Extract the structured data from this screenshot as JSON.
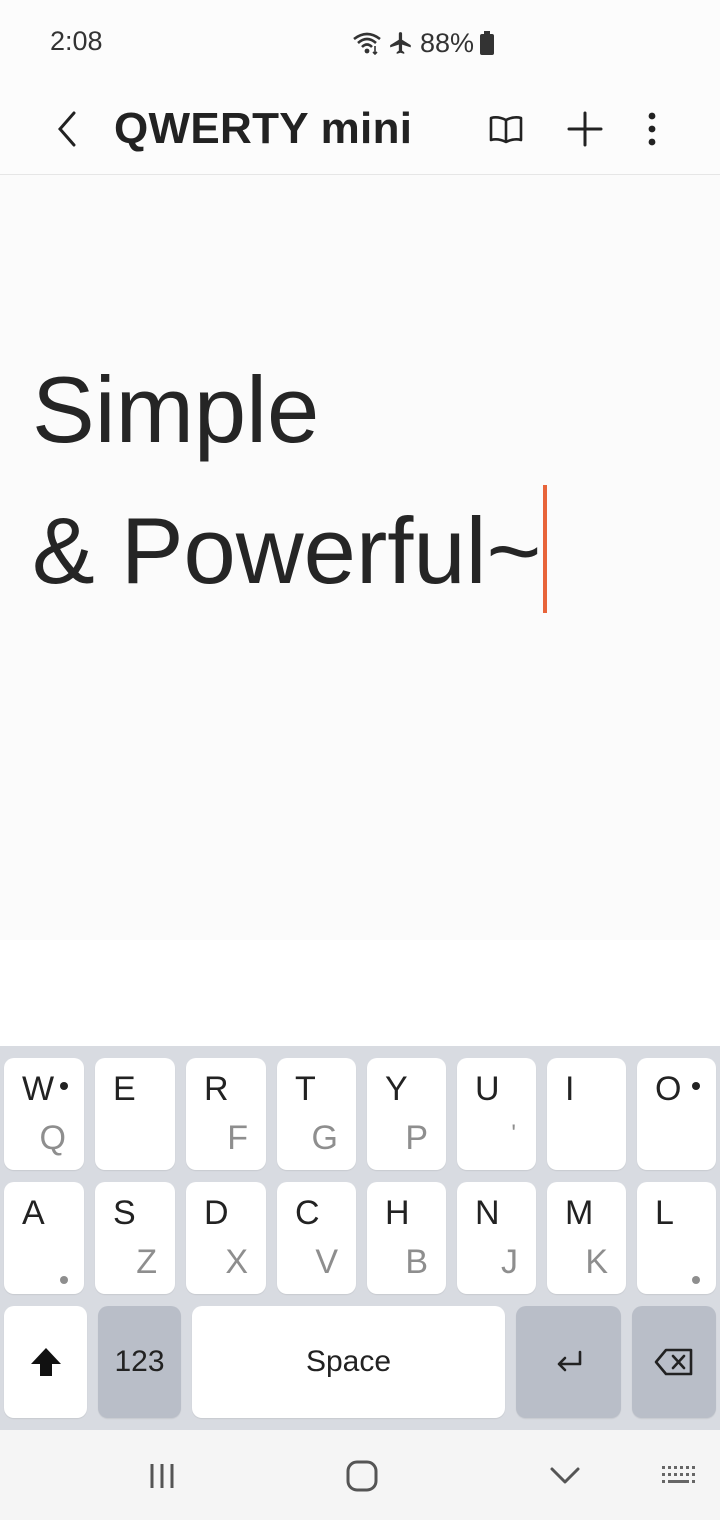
{
  "status_bar": {
    "time": "2:08",
    "battery": "88%",
    "icons": [
      "wifi-icon",
      "airplane-icon",
      "battery-icon"
    ]
  },
  "app_bar": {
    "title": "QWERTY mini",
    "icons": [
      "back-icon",
      "book-icon",
      "add-icon",
      "more-icon"
    ]
  },
  "editor": {
    "line1": "Simple",
    "line2": "& Powerful~",
    "cursor_color": "#e8643a"
  },
  "keyboard": {
    "row1": [
      {
        "primary": "W",
        "secondary": "Q"
      },
      {
        "primary": "E",
        "secondary": ""
      },
      {
        "primary": "R",
        "secondary": "F"
      },
      {
        "primary": "T",
        "secondary": "G"
      },
      {
        "primary": "Y",
        "secondary": "P"
      },
      {
        "primary": "U",
        "secondary": "'"
      },
      {
        "primary": "I",
        "secondary": ""
      },
      {
        "primary": "O",
        "secondary": ""
      }
    ],
    "row2": [
      {
        "primary": "A",
        "secondary": ""
      },
      {
        "primary": "S",
        "secondary": "Z"
      },
      {
        "primary": "D",
        "secondary": "X"
      },
      {
        "primary": "C",
        "secondary": "V"
      },
      {
        "primary": "H",
        "secondary": "B"
      },
      {
        "primary": "N",
        "secondary": "J"
      },
      {
        "primary": "M",
        "secondary": "K"
      },
      {
        "primary": "L",
        "secondary": ""
      }
    ],
    "numbers_label": "123",
    "space_label": "Space",
    "icons": [
      "shift-icon",
      "enter-icon",
      "backspace-icon"
    ]
  },
  "nav_bar": {
    "icons": [
      "recents-icon",
      "home-icon",
      "hide-keyboard-icon",
      "keyboard-switch-icon"
    ]
  }
}
